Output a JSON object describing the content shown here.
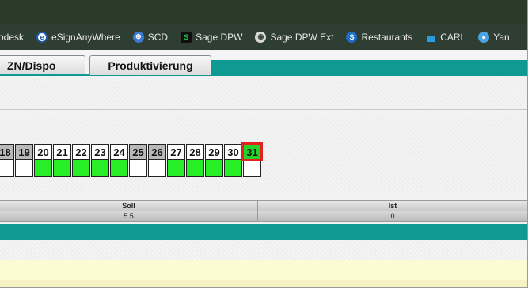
{
  "bookmarks": [
    {
      "label": "odesk",
      "icon": "none",
      "color": ""
    },
    {
      "label": "eSignAnyWhere",
      "icon": "esign-icon",
      "color": "#1e5aa8"
    },
    {
      "label": "SCD",
      "icon": "globe-icon",
      "color": "#3a7bd5"
    },
    {
      "label": "Sage DPW",
      "icon": "sage-icon",
      "color": "#17a34a"
    },
    {
      "label": "Sage DPW Ext",
      "icon": "globe-icon",
      "color": "#cccccc"
    },
    {
      "label": "Restaurants",
      "icon": "sharepoint-icon",
      "color": "#1b6fc5"
    },
    {
      "label": "CARL",
      "icon": "bar-icon",
      "color": "#2a9de0"
    },
    {
      "label": "Yan",
      "icon": "yandex-icon",
      "color": "#4aa3e0"
    }
  ],
  "tabs": {
    "t1": "ZN/Dispo",
    "t2": "Produktivierung"
  },
  "calendar": {
    "days": [
      {
        "n": "",
        "weekend": false,
        "green": true,
        "partial": true
      },
      {
        "n": "18",
        "weekend": true,
        "green": false
      },
      {
        "n": "19",
        "weekend": true,
        "green": false
      },
      {
        "n": "20",
        "weekend": false,
        "green": true
      },
      {
        "n": "21",
        "weekend": false,
        "green": true
      },
      {
        "n": "22",
        "weekend": false,
        "green": true
      },
      {
        "n": "23",
        "weekend": false,
        "green": true
      },
      {
        "n": "24",
        "weekend": false,
        "green": true
      },
      {
        "n": "25",
        "weekend": true,
        "green": false
      },
      {
        "n": "26",
        "weekend": true,
        "green": false
      },
      {
        "n": "27",
        "weekend": false,
        "green": true
      },
      {
        "n": "28",
        "weekend": false,
        "green": true
      },
      {
        "n": "29",
        "weekend": false,
        "green": true
      },
      {
        "n": "30",
        "weekend": false,
        "green": true
      },
      {
        "n": "31",
        "weekend": false,
        "green": false,
        "today": true
      }
    ]
  },
  "table": {
    "headers": [
      "Soll",
      "Ist"
    ],
    "values": [
      "5.5",
      "0"
    ]
  },
  "colors": {
    "teal": "#0e9a92",
    "green": "#27ee27",
    "today_outline": "#e32020"
  }
}
